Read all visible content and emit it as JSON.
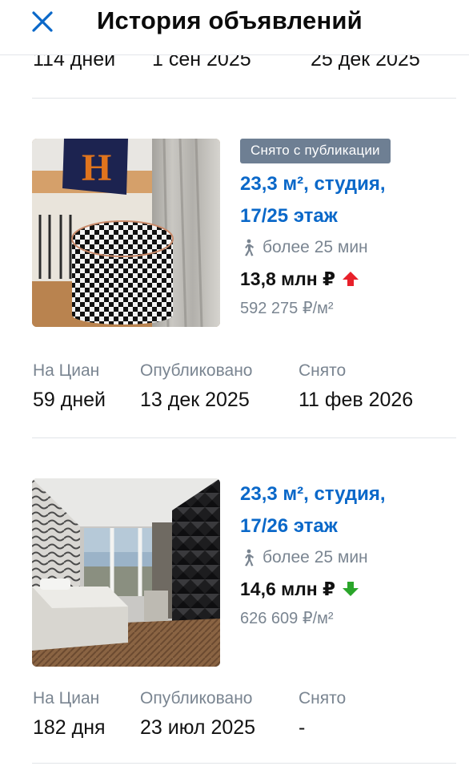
{
  "header": {
    "title": "История объявлений"
  },
  "previous_row": {
    "on_cian": "114 дней",
    "published": "1 сен 2025",
    "removed": "25 дек 2025"
  },
  "listings": [
    {
      "badge": "Снято с публикации",
      "title_line1": "23,3 м², студия,",
      "title_line2": "17/25 этаж",
      "walk": "более 25 мин",
      "price": "13,8 млн ₽",
      "price_trend": "up",
      "price_per_m2": "592 275 ₽/м²",
      "labels": {
        "on_cian": "На Циан",
        "published": "Опубликовано",
        "removed": "Снято"
      },
      "values": {
        "on_cian": "59 дней",
        "published": "13 дек 2025",
        "removed": "11 фев 2026"
      }
    },
    {
      "badge": "",
      "title_line1": "23,3 м², студия,",
      "title_line2": "17/26 этаж",
      "walk": "более 25 мин",
      "price": "14,6 млн ₽",
      "price_trend": "down",
      "price_per_m2": "626 609 ₽/м²",
      "labels": {
        "on_cian": "На Циан",
        "published": "Опубликовано",
        "removed": "Снято"
      },
      "values": {
        "on_cian": "182 дня",
        "published": "23 июл 2025",
        "removed": "-"
      }
    }
  ],
  "colors": {
    "link": "#0a68c9",
    "muted": "#7a8591",
    "badge_bg": "#6e7f93",
    "up_arrow": "#e8202a",
    "down_arrow": "#2aa52a"
  }
}
